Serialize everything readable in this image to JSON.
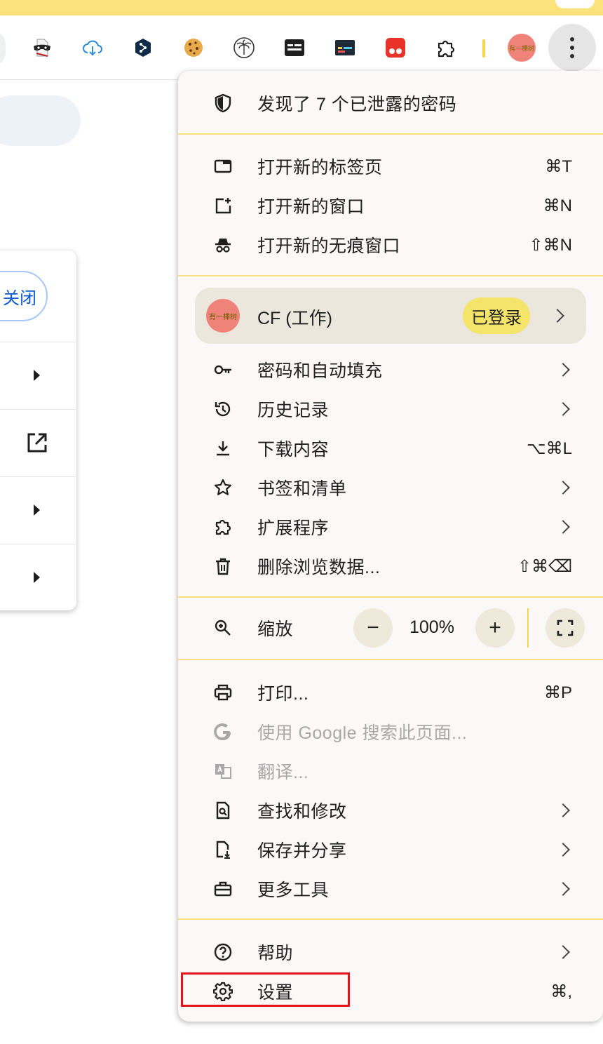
{
  "toolbar": {
    "extensions": [
      "incognito-mask-extension-icon",
      "cloud-download-icon",
      "deepl-icon",
      "cookie-icon",
      "palm-tree-icon",
      "keyboard-extension-icon",
      "terminal-extension-icon",
      "red-dots-extension-icon",
      "puzzle-extensions-icon"
    ],
    "profile_avatar_text": "有一棵树",
    "menu_button": "more-options"
  },
  "page": {
    "close_button_label": "关闭"
  },
  "menu": {
    "password_alert": {
      "label": "发现了 7 个已泄露的密码",
      "icon": "shield-icon"
    },
    "new_tab": {
      "label": "打开新的标签页",
      "shortcut": "⌘T"
    },
    "new_window": {
      "label": "打开新的窗口",
      "shortcut": "⌘N"
    },
    "new_incognito": {
      "label": "打开新的无痕窗口",
      "shortcut": "⇧⌘N"
    },
    "profile": {
      "name": "CF (工作)",
      "status": "已登录",
      "avatar_text": "有一棵树"
    },
    "passwords": {
      "label": "密码和自动填充"
    },
    "history": {
      "label": "历史记录"
    },
    "downloads": {
      "label": "下载内容",
      "shortcut": "⌥⌘L"
    },
    "bookmarks": {
      "label": "书签和清单"
    },
    "extensions": {
      "label": "扩展程序"
    },
    "clear_data": {
      "label": "删除浏览数据...",
      "shortcut": "⇧⌘⌫"
    },
    "zoom": {
      "label": "缩放",
      "value": "100%",
      "minus": "−",
      "plus": "+"
    },
    "print": {
      "label": "打印...",
      "shortcut": "⌘P"
    },
    "search_google": {
      "label": "使用 Google 搜索此页面..."
    },
    "translate": {
      "label": "翻译..."
    },
    "find_edit": {
      "label": "查找和修改"
    },
    "save_share": {
      "label": "保存并分享"
    },
    "more_tools": {
      "label": "更多工具"
    },
    "help": {
      "label": "帮助"
    },
    "settings": {
      "label": "设置",
      "shortcut": "⌘,"
    }
  },
  "colors": {
    "menu_bg": "#fcf8f8",
    "separator": "#f7e07d",
    "profile_bg": "#ece7dd",
    "badge": "#f5e46a",
    "highlight": "#e0161b",
    "disabled_text": "#a8a8a8"
  }
}
